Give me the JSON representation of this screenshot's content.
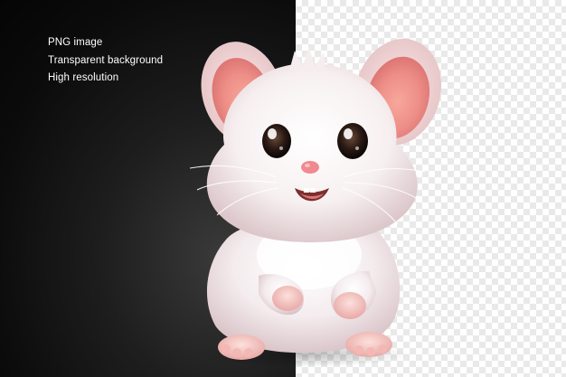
{
  "captions": [
    "PNG image",
    "Transparent background",
    "High resolution"
  ]
}
